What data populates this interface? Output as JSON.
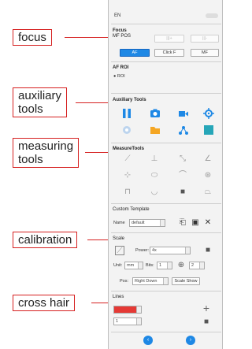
{
  "panel": {
    "top_label": "EN",
    "focus": {
      "title": "Focus",
      "subtitle": "MF POS",
      "buttons": [
        "AF",
        "Click F",
        "MF"
      ],
      "faint_buttons": [
        "|||+",
        "|||-"
      ]
    },
    "af_roi": {
      "title": "AF ROI",
      "option": "ROI"
    },
    "auxiliary": {
      "title": "Auxiliary Tools"
    },
    "measure": {
      "title": "MeasureTools"
    },
    "custom_template": {
      "title": "Custom Template",
      "name_label": "Name",
      "name_value": "default"
    },
    "scale": {
      "title": "Scale",
      "power_label": "Power:",
      "power_value": "4x",
      "unit_label": "Unit:",
      "unit_value": "mm",
      "bits_label": "Bits:",
      "bits_value": "1",
      "zoom_value": "2",
      "pos_label": "Pos:",
      "pos_value": "Right Down",
      "show_button": "Scale Show"
    },
    "lines": {
      "title": "Lines",
      "color": "#e53935",
      "width_value": "1"
    }
  },
  "annotations": [
    "focus",
    "auxiliary\ntools",
    "measuring\ntools",
    "calibration",
    "cross hair"
  ],
  "colors": {
    "accent": "#1e88e5",
    "annotation": "#d62020"
  }
}
